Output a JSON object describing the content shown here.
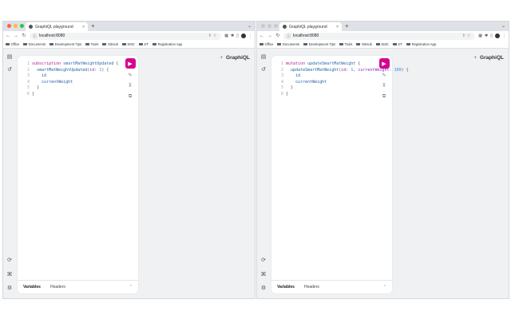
{
  "windows": [
    {
      "tab_title": "GraphiQL playground",
      "tab_close": "×",
      "new_tab": "+",
      "url": "localhost:8080",
      "bookmarks": [
        "Office",
        "Documents",
        "Development Tips",
        "Tools",
        "GitHub",
        "SMC",
        "JIT",
        "Registration App"
      ],
      "header_plus": "+",
      "header_title": "GraphiQL",
      "code_lines": [
        [
          {
            "t": "subscription ",
            "c": "kw"
          },
          {
            "t": "smartMatWeightUpdated",
            "c": "fn"
          },
          {
            "t": " {",
            "c": "punc"
          }
        ],
        [
          {
            "t": "  ",
            "c": "punc"
          },
          {
            "t": "smartMatWeightUpdated",
            "c": "field"
          },
          {
            "t": "(",
            "c": "punc"
          },
          {
            "t": "id",
            "c": "arg"
          },
          {
            "t": ": ",
            "c": "punc"
          },
          {
            "t": "1",
            "c": "num"
          },
          {
            "t": ") {",
            "c": "punc"
          }
        ],
        [
          {
            "t": "    ",
            "c": "punc"
          },
          {
            "t": "id",
            "c": "field"
          }
        ],
        [
          {
            "t": "    ",
            "c": "punc"
          },
          {
            "t": "currentWeight",
            "c": "field"
          }
        ],
        [
          {
            "t": "  }",
            "c": "punc"
          }
        ],
        [
          {
            "t": "}",
            "c": "punc"
          }
        ]
      ],
      "variables_tab": "Variables",
      "headers_tab": "Headers"
    },
    {
      "tab_title": "GraphiQL playground",
      "tab_close": "×",
      "new_tab": "+",
      "url": "localhost:8080",
      "bookmarks": [
        "Office",
        "Documents",
        "Development Tips",
        "Tools",
        "GitHub",
        "SMC",
        "JIT",
        "Registration App"
      ],
      "header_plus": "+",
      "header_title": "GraphiQL",
      "code_lines": [
        [
          {
            "t": "mutation ",
            "c": "kw"
          },
          {
            "t": "updateSmartMatWeight",
            "c": "fn"
          },
          {
            "t": " {",
            "c": "punc"
          }
        ],
        [
          {
            "t": "  ",
            "c": "punc"
          },
          {
            "t": "updateSmartMatWeight",
            "c": "field"
          },
          {
            "t": "(",
            "c": "punc"
          },
          {
            "t": "id",
            "c": "arg"
          },
          {
            "t": ": ",
            "c": "punc"
          },
          {
            "t": "1",
            "c": "num"
          },
          {
            "t": ", ",
            "c": "punc"
          },
          {
            "t": "currentWeight",
            "c": "arg"
          },
          {
            "t": ": ",
            "c": "punc"
          },
          {
            "t": "100",
            "c": "num"
          },
          {
            "t": ") {",
            "c": "punc"
          }
        ],
        [
          {
            "t": "    ",
            "c": "punc"
          },
          {
            "t": "id",
            "c": "field"
          }
        ],
        [
          {
            "t": "    ",
            "c": "punc"
          },
          {
            "t": "currentWeight",
            "c": "field"
          }
        ],
        [
          {
            "t": "  }",
            "c": "punc"
          }
        ],
        [
          {
            "t": "}",
            "c": "punc"
          }
        ]
      ],
      "variables_tab": "Variables",
      "headers_tab": "Headers"
    }
  ],
  "colors": {
    "run_button": "#d60590",
    "traffic_red": "#ff5f57",
    "traffic_yellow": "#febc2e",
    "traffic_green": "#28c840",
    "inactive_light": "#c9c9cc"
  },
  "icons": {
    "run": "play-icon",
    "prettify": "prettify-icon",
    "merge": "merge-fragments-icon",
    "copy": "copy-icon",
    "docs": "docs-icon",
    "history": "history-icon",
    "refetch": "refetch-schema-icon",
    "shortcuts": "keyboard-shortcuts-icon",
    "settings": "settings-icon"
  }
}
